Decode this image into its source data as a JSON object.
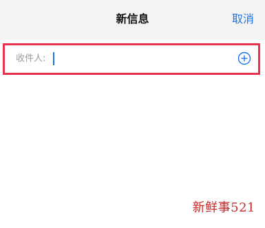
{
  "header": {
    "title": "新信息",
    "cancel_label": "取消"
  },
  "recipient": {
    "label": "收件人:",
    "value": "",
    "add_icon": "plus-circle-icon",
    "highlight_color": "#e8314b"
  },
  "watermark": {
    "text": "新鲜事521",
    "color": "#c62828"
  },
  "colors": {
    "accent": "#1a73e8",
    "navbar_background": "#f4f4f4"
  }
}
